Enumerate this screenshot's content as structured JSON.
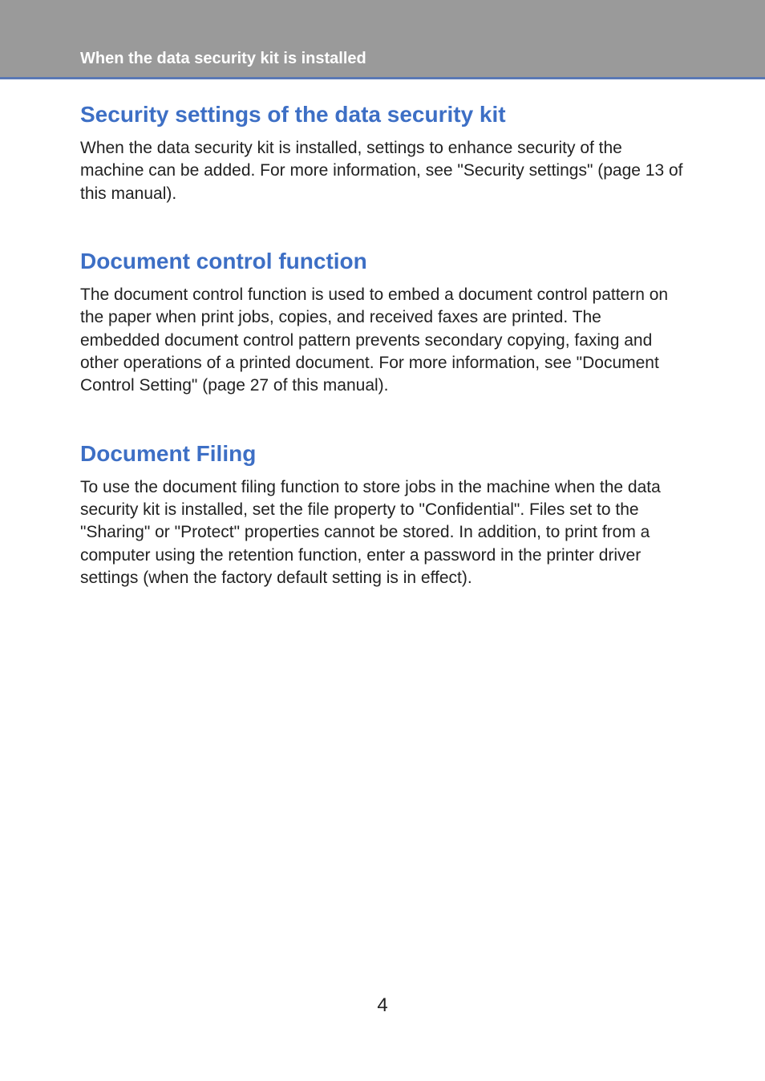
{
  "header": {
    "title": "When the data security kit is installed"
  },
  "sections": [
    {
      "heading": "Security settings of the data security kit",
      "body": "When the data security kit is installed, settings to enhance security of the machine can be added. For more information, see \"Security settings\" (page 13 of this manual)."
    },
    {
      "heading": "Document control function",
      "body": "The document control function is used to embed a document control pattern on the paper when print jobs, copies, and received faxes are printed. The embedded document control pattern prevents secondary copying, faxing and other operations of a printed document. For more information, see \"Document Control Setting\" (page 27 of this manual)."
    },
    {
      "heading": "Document Filing",
      "body": "To use the document filing function to store jobs in the machine when the data security kit is installed, set the file property to \"Confidential\". Files set to the \"Sharing\" or \"Protect\" properties cannot be stored. In addition, to print from a computer using the retention function, enter a password in the printer driver settings (when the factory default setting is in effect)."
    }
  ],
  "page_number": "4"
}
